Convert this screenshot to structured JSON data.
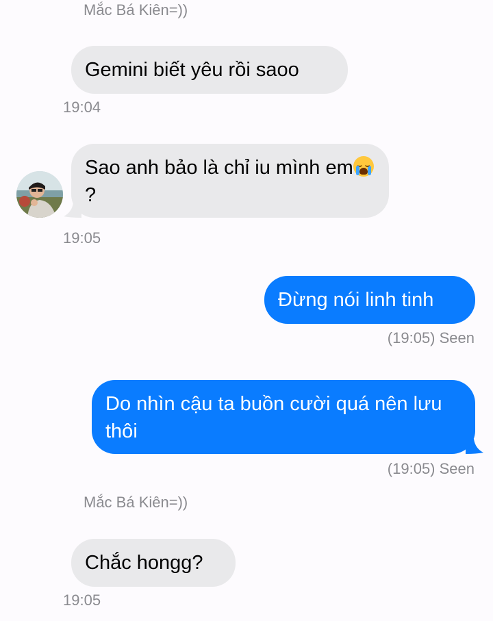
{
  "conversation": {
    "sender_name_1": "Mắc Bá Kiên=))",
    "msg1": {
      "text": "Gemini biết yêu rồi saoo",
      "time": "19:04"
    },
    "msg2": {
      "text_before": "Sao anh bảo là chỉ iu mình em",
      "emoji": "crying-face-emoji",
      "text_after": "?",
      "time": "19:05"
    },
    "msg3": {
      "text": "Đừng nói linh tinh",
      "status": "(19:05) Seen"
    },
    "msg4": {
      "text": "Do nhìn cậu ta buồn cười quá nên lưu thôi",
      "status": "(19:05) Seen"
    },
    "sender_name_2": "Mắc Bá Kiên=))",
    "msg5": {
      "text": "Chắc hongg?",
      "time": "19:05"
    }
  },
  "colors": {
    "incoming_bubble": "#e9e9eb",
    "outgoing_bubble": "#0a7cff",
    "meta_text": "#8a8a8f",
    "background": "#fdfbfe"
  }
}
